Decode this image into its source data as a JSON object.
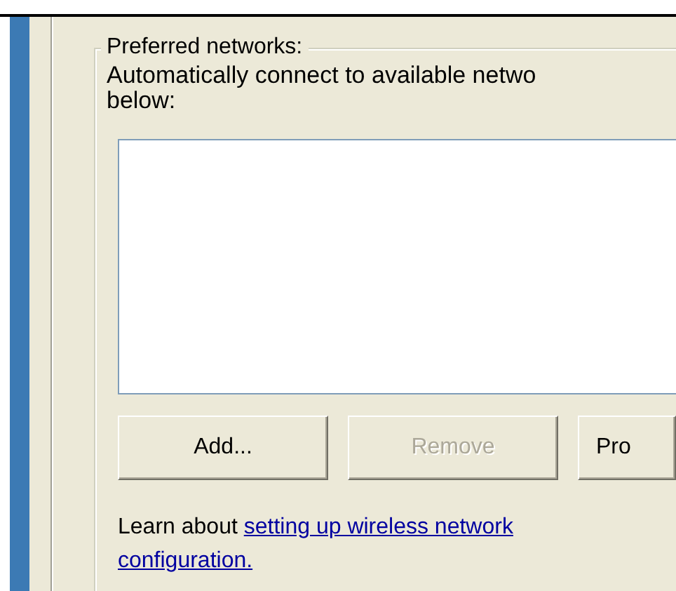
{
  "group": {
    "title": "Preferred networks:",
    "description_lines": [
      "Automatically connect to available netwo",
      "below:"
    ]
  },
  "buttons": [
    {
      "label": "Add...",
      "disabled": false
    },
    {
      "label": "Remove",
      "disabled": true
    },
    {
      "label": "Pro",
      "disabled": false
    }
  ],
  "footer": {
    "text": "Learn about ",
    "link_lines": [
      "setting up wireless network",
      "configuration."
    ]
  }
}
